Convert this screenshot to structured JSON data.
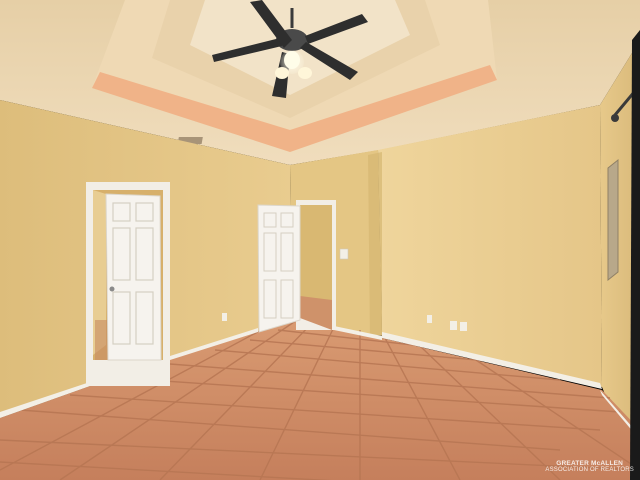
{
  "scene": {
    "description_kind": "interior-room-photo",
    "colors": {
      "wall": "#e7c98a",
      "wall_shadow": "#d8b675",
      "ceiling": "#ecd7b2",
      "tray_glow": "#f0a67a",
      "floor_tile": "#c98763",
      "grout": "#b77653",
      "door": "#f6f3ee",
      "baseboard": "#f3efe6"
    },
    "icons": [
      "ceiling-fan-icon",
      "door-icon",
      "electrical-panel-icon",
      "outlet-icon",
      "light-switch-icon"
    ]
  },
  "watermark": {
    "line1": "GREATER McALLEN",
    "line2": "ASSOCIATION OF REALTORS"
  }
}
